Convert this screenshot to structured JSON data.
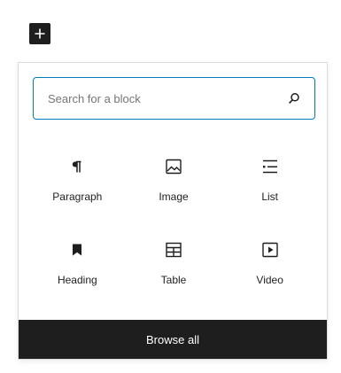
{
  "toolbar": {
    "add_icon": "plus-icon"
  },
  "inserter": {
    "search": {
      "placeholder": "Search for a block",
      "value": "",
      "icon": "search-icon"
    },
    "blocks": [
      {
        "label": "Paragraph",
        "icon": "paragraph-icon"
      },
      {
        "label": "Image",
        "icon": "image-icon"
      },
      {
        "label": "List",
        "icon": "list-icon"
      },
      {
        "label": "Heading",
        "icon": "bookmark-icon"
      },
      {
        "label": "Table",
        "icon": "table-icon"
      },
      {
        "label": "Video",
        "icon": "video-icon"
      }
    ],
    "browse_all_label": "Browse all"
  },
  "colors": {
    "accent": "#007cba",
    "dark": "#1e1e1e",
    "border": "#dcdcde"
  }
}
